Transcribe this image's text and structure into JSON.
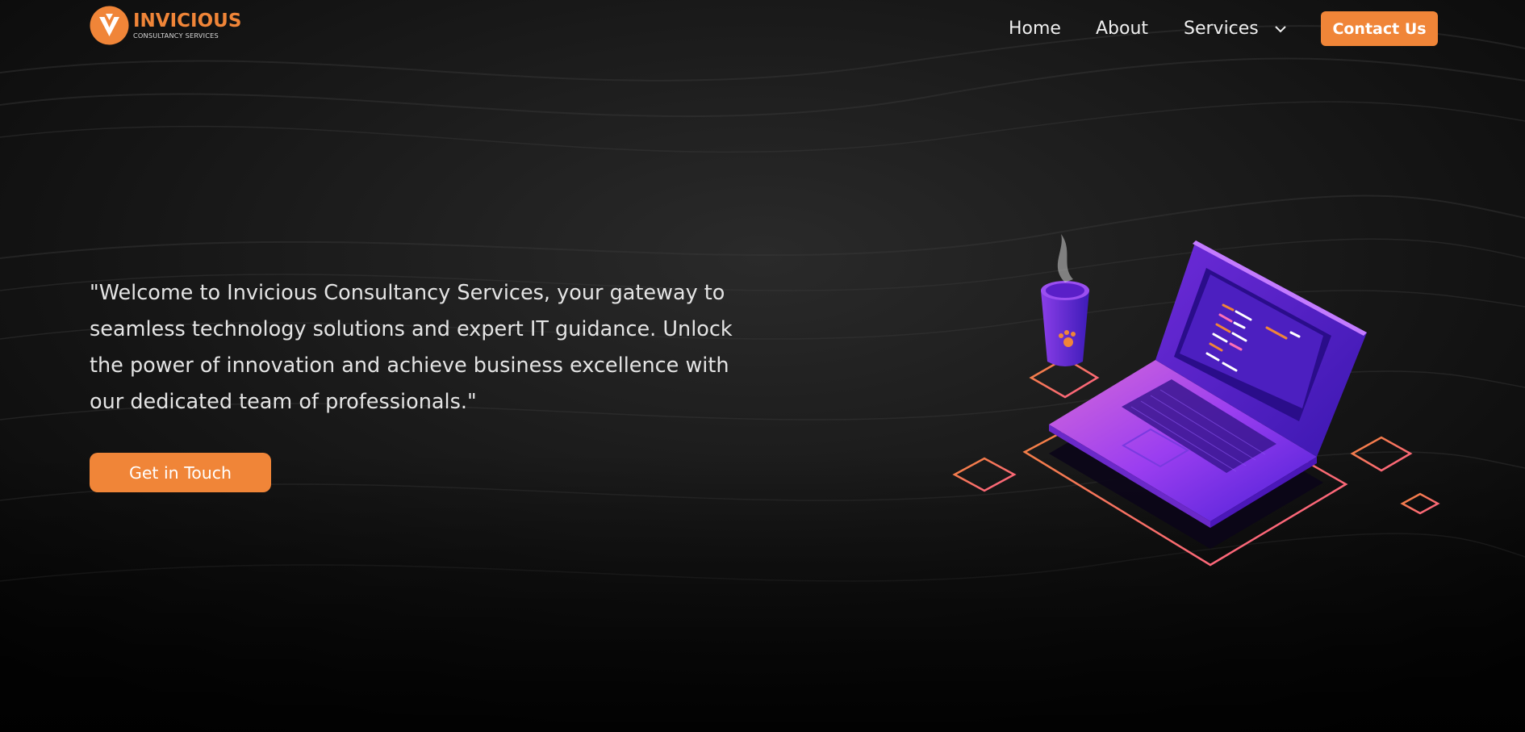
{
  "brand": {
    "name": "INVICIOUS",
    "tagline": "CONSULTANCY SERVICES",
    "color": "#f08538"
  },
  "nav": {
    "items": [
      {
        "label": "Home"
      },
      {
        "label": "About"
      },
      {
        "label": "Services",
        "icon": "chevron-down-icon"
      }
    ],
    "contact_label": "Contact Us"
  },
  "hero": {
    "quote": "\"Welcome to Invicious Consultancy Services, your gateway to seamless technology solutions and expert IT guidance. Unlock the power of innovation and achieve business excellence with our dedicated team of professionals.\"",
    "cta_label": "Get in Touch"
  },
  "illustration": {
    "subject": "isometric laptop with code and coffee cup",
    "accent_colors": [
      "#8a2be2",
      "#f08538",
      "#ff6f7f"
    ]
  }
}
